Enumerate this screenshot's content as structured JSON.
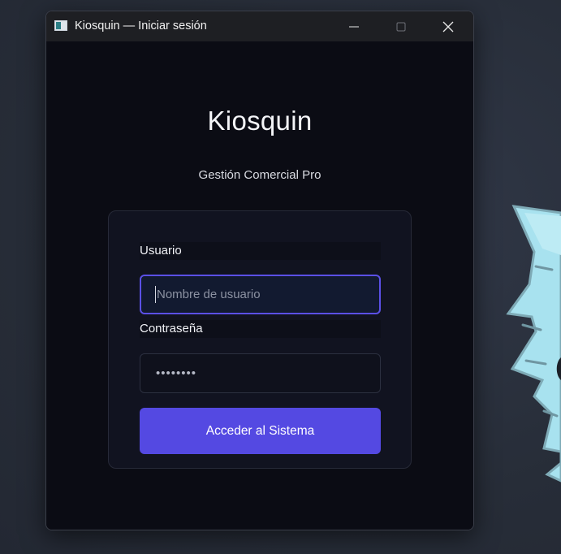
{
  "window": {
    "title": "Kiosquin — Iniciar sesión"
  },
  "caption_buttons": {
    "minimize_icon": "minimize-icon",
    "maximize_icon": "maximize-icon",
    "close_icon": "close-icon"
  },
  "brand": {
    "title": "Kiosquin",
    "subtitle": "Gestión Comercial Pro"
  },
  "login": {
    "user_label": "Usuario",
    "user_value": "",
    "user_placeholder": "Nombre de usuario",
    "password_label": "Contraseña",
    "password_value": "••••••••",
    "submit_label": "Acceder al Sistema"
  },
  "colors": {
    "accent": "#5449e2",
    "focus_border": "#5b50e6",
    "window_bg": "#0b0c14",
    "card_bg": "#111320",
    "desktop_bg": "#2a303b"
  }
}
